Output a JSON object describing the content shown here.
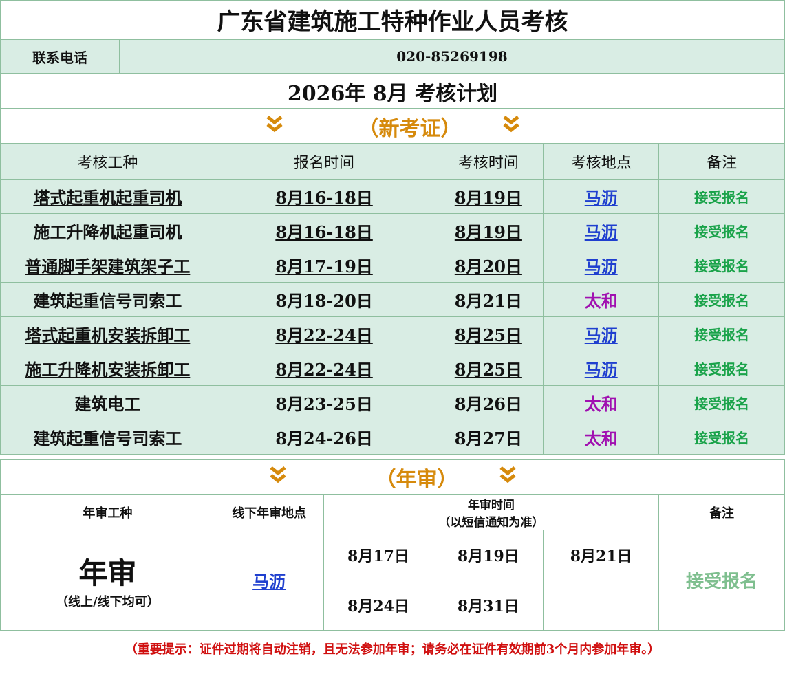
{
  "title": "广东省建筑施工特种作业人员考核",
  "phone": {
    "label": "联系电话",
    "value": "020-85269198"
  },
  "plan_title": "2026年  8月  考核计划",
  "section_new": {
    "label": "（新考证）",
    "chevron": "»"
  },
  "table_new": {
    "headers": [
      "考核工种",
      "报名时间",
      "考核时间",
      "考核地点",
      "备注"
    ],
    "rows": [
      [
        "塔式起重机起重司机",
        "8月16-18日",
        "8月19日",
        "马沥",
        "接受报名"
      ],
      [
        "施工升降机起重司机",
        "8月16-18日",
        "8月19日",
        "马沥",
        "接受报名"
      ],
      [
        "普通脚手架建筑架子工",
        "8月17-19日",
        "8月20日",
        "马沥",
        "接受报名"
      ],
      [
        "建筑起重信号司索工",
        "8月18-20日",
        "8月21日",
        "太和",
        "接受报名"
      ],
      [
        "塔式起重机安装拆卸工",
        "8月22-24日",
        "8月25日",
        "马沥",
        "接受报名"
      ],
      [
        "施工升降机安装拆卸工",
        "8月22-24日",
        "8月25日",
        "马沥",
        "接受报名"
      ],
      [
        "建筑电工",
        "8月23-25日",
        "8月26日",
        "太和",
        "接受报名"
      ],
      [
        "建筑起重信号司索工",
        "8月24-26日",
        "8月27日",
        "太和",
        "接受报名"
      ]
    ]
  },
  "section_annual": {
    "label": "（年审）"
  },
  "table_annual": {
    "headers": {
      "type": "年审工种",
      "location": "线下年审地点",
      "time": "年审时间",
      "time_note": "（以短信通知为准）",
      "note": "备注"
    },
    "type_big": "年审",
    "type_sub": "（线上/线下均可）",
    "location": "马沥",
    "dates": [
      "8月17日",
      "8月19日",
      "8月21日",
      "8月24日",
      "8月31日"
    ],
    "note": "接受报名"
  },
  "warning": "（重要提示：证件过期将自动注销，且无法参加年审；请务必在证件有效期前3个月内参加年审。）"
}
